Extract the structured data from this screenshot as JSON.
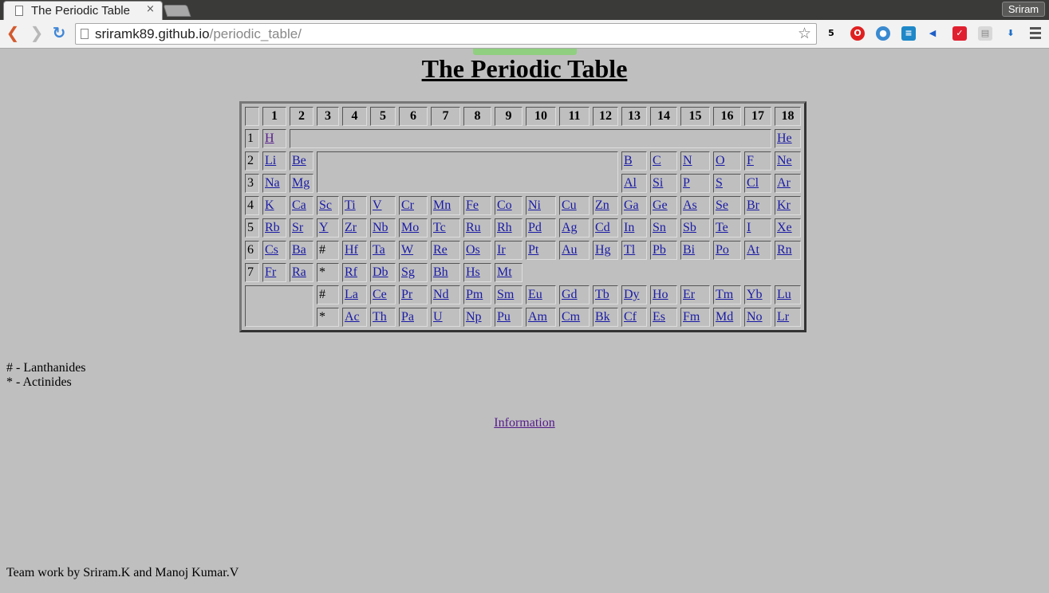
{
  "browser": {
    "tab_title": "The Periodic Table",
    "tab_close": "×",
    "user": "Sriram",
    "url_host": "sriramk89.github.io",
    "url_path": "/periodic_table/",
    "star": "☆"
  },
  "page": {
    "title": "The Periodic Table",
    "legend_lanthanides": "# - Lanthanides",
    "legend_actinides": "* - Actinides",
    "info_link": "Information",
    "footer": "Team work by Sriram.K and Manoj Kumar.V"
  },
  "groups": [
    "1",
    "2",
    "3",
    "4",
    "5",
    "6",
    "7",
    "8",
    "9",
    "10",
    "11",
    "12",
    "13",
    "14",
    "15",
    "16",
    "17",
    "18"
  ],
  "periods": [
    "1",
    "2",
    "3",
    "4",
    "5",
    "6",
    "7"
  ],
  "elements": {
    "p1": [
      "H",
      "He"
    ],
    "p2": [
      "Li",
      "Be",
      "B",
      "C",
      "N",
      "O",
      "F",
      "Ne"
    ],
    "p3": [
      "Na",
      "Mg",
      "Al",
      "Si",
      "P",
      "S",
      "Cl",
      "Ar"
    ],
    "p4": [
      "K",
      "Ca",
      "Sc",
      "Ti",
      "V",
      "Cr",
      "Mn",
      "Fe",
      "Co",
      "Ni",
      "Cu",
      "Zn",
      "Ga",
      "Ge",
      "As",
      "Se",
      "Br",
      "Kr"
    ],
    "p5": [
      "Rb",
      "Sr",
      "Y",
      "Zr",
      "Nb",
      "Mo",
      "Tc",
      "Ru",
      "Rh",
      "Pd",
      "Ag",
      "Cd",
      "In",
      "Sn",
      "Sb",
      "Te",
      "I",
      "Xe"
    ],
    "p6": [
      "Cs",
      "Ba",
      "#",
      "Hf",
      "Ta",
      "W",
      "Re",
      "Os",
      "Ir",
      "Pt",
      "Au",
      "Hg",
      "Tl",
      "Pb",
      "Bi",
      "Po",
      "At",
      "Rn"
    ],
    "p7": [
      "Fr",
      "Ra",
      "*",
      "Rf",
      "Db",
      "Sg",
      "Bh",
      "Hs",
      "Mt"
    ],
    "lanthanides": [
      "#",
      "La",
      "Ce",
      "Pr",
      "Nd",
      "Pm",
      "Sm",
      "Eu",
      "Gd",
      "Tb",
      "Dy",
      "Ho",
      "Er",
      "Tm",
      "Yb",
      "Lu"
    ],
    "actinides": [
      "*",
      "Ac",
      "Th",
      "Pa",
      "U",
      "Np",
      "Pu",
      "Am",
      "Cm",
      "Bk",
      "Cf",
      "Es",
      "Fm",
      "Md",
      "No",
      "Lr"
    ]
  },
  "colors": {
    "background": "#bfbfbf",
    "link": "#1a1aa6",
    "visited_link": "#551a8b"
  }
}
